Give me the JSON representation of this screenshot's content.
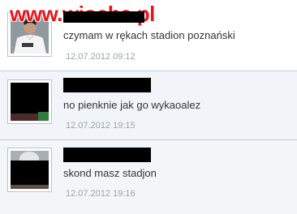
{
  "watermark": "www.wiocha.pl",
  "comments": [
    {
      "message": "czymam w rękach stadion poznański",
      "date": "12.07.2012 09:12"
    },
    {
      "message": "no pienknie jak go wykaoalez",
      "date": "12.07.2012 19:15"
    },
    {
      "message": "skond masz stadjon",
      "date": "12.07.2012 19:16"
    }
  ]
}
